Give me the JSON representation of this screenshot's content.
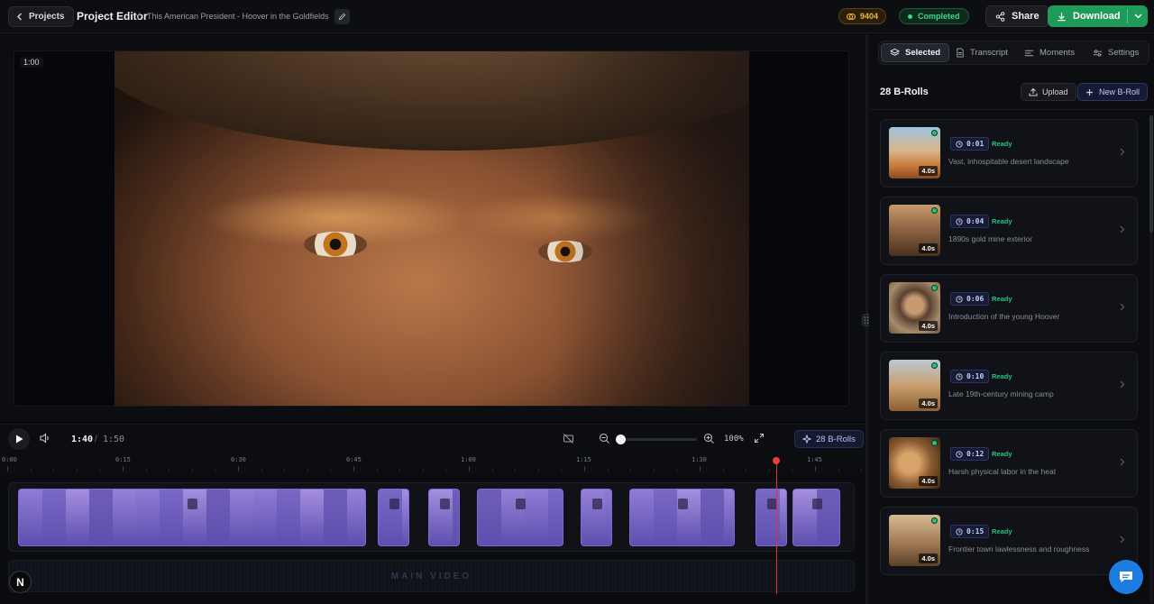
{
  "header": {
    "back_label": "Projects",
    "title": "Project Editor",
    "separator": "/",
    "project_name": "This American President - Hoover in the Goldfields",
    "credits": "9404",
    "status": "Completed",
    "share_label": "Share",
    "download_label": "Download"
  },
  "preview": {
    "badge": "1:00"
  },
  "player": {
    "current_time": "1:40",
    "time_separator": "/",
    "total_time": "1:50",
    "zoom": "100%",
    "broll_count_label": "28 B-Rolls",
    "progress_fraction": 0.909
  },
  "ruler": {
    "ticks": [
      "0:00",
      "0:15",
      "0:30",
      "0:45",
      "1:00",
      "1:15",
      "1:30",
      "1:45"
    ]
  },
  "tracks": {
    "main_video_label": "MAIN VIDEO"
  },
  "panel": {
    "tabs": [
      {
        "label": "Selected",
        "icon": "layers-icon"
      },
      {
        "label": "Transcript",
        "icon": "document-icon"
      },
      {
        "label": "Moments",
        "icon": "list-icon"
      },
      {
        "label": "Settings",
        "icon": "sliders-icon"
      }
    ],
    "heading": "28 B-Rolls",
    "upload_label": "Upload",
    "new_label": "New B-Roll",
    "items": [
      {
        "time": "0:01",
        "status": "Ready",
        "duration": "4.0s",
        "description": "Vast, inhospitable desert landscape"
      },
      {
        "time": "0:04",
        "status": "Ready",
        "duration": "4.0s",
        "description": "1890s gold mine exterior"
      },
      {
        "time": "0:06",
        "status": "Ready",
        "duration": "4.0s",
        "description": "Introduction of the young Hoover"
      },
      {
        "time": "0:10",
        "status": "Ready",
        "duration": "4.0s",
        "description": "Late 19th-century mining camp"
      },
      {
        "time": "0:12",
        "status": "Ready",
        "duration": "4.0s",
        "description": "Harsh physical labor in the heat"
      },
      {
        "time": "0:15",
        "status": "Ready",
        "duration": "4.0s",
        "description": "Frontier town lawlessness and roughness"
      }
    ]
  },
  "misc": {
    "avatar_letter": "N"
  },
  "colors": {
    "accent_green": "#1f9a59",
    "ready_green": "#28c57f",
    "playhead_red": "#ef3b43",
    "clip_purple": "#7d6ad8"
  }
}
